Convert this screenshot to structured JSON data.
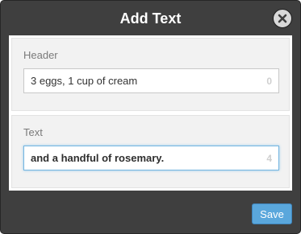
{
  "dialog": {
    "title": "Add Text",
    "close_icon": "close-icon",
    "save_label": "Save"
  },
  "fields": {
    "header": {
      "label": "Header",
      "value": "3 eggs, 1 cup of cream",
      "count": "0",
      "focused": false
    },
    "text": {
      "label": "Text",
      "value": "and a handful of rosemary.",
      "count": "4",
      "focused": true
    }
  },
  "colors": {
    "dialog_background": "#3f3f3f",
    "panel_background": "#f2f2f2",
    "save_button": "#5aa7dc",
    "focus_border": "#74b5e0"
  }
}
